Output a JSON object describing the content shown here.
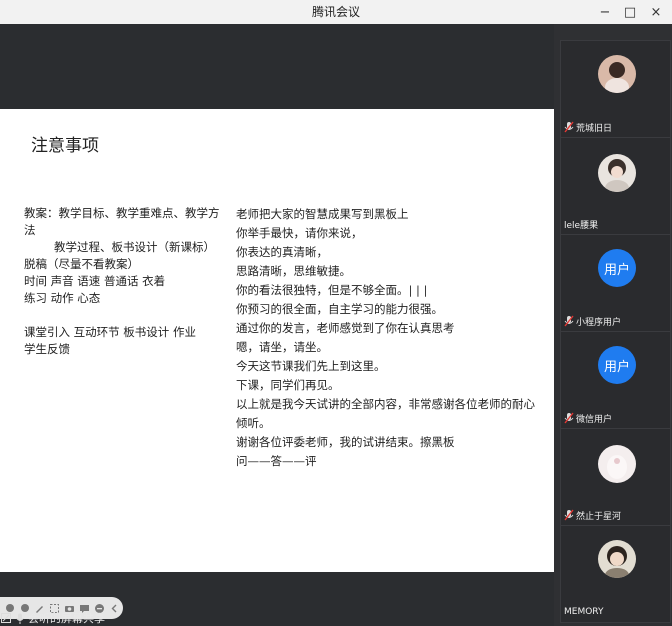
{
  "window": {
    "title": "腾讯会议",
    "minimize": "−",
    "maximize": "□",
    "close": "×"
  },
  "slide": {
    "heading": "注意事项",
    "left_lines": [
      "教案：教学目标、教学重难点、教学方法",
      "教学过程、板书设计（新课标）",
      "脱稿（尽量不看教案）",
      "时间 声音 语速 普通话 衣着",
      "练习 动作 心态",
      "",
      "课堂引入 互动环节 板书设计 作业",
      "学生反馈"
    ],
    "right_lines": [
      "老师把大家的智慧成果写到黑板上",
      "你举手最快，请你来说，",
      "你表达的真清晰，",
      "思路清晰，思维敏捷。",
      "你的看法很独特，但是不够全面。| | |",
      "你预习的很全面，自主学习的能力很强。",
      "通过你的发言，老师感觉到了你在认真思考",
      "嗯，请坐，请坐。",
      "今天这节课我们先上到这里。",
      "下课，同学们再见。",
      "以上就是我今天试讲的全部内容，非常感谢各位老师的耐心倾听。",
      "谢谢各位评委老师，我的试讲结束。擦黑板",
      "问——答——评"
    ]
  },
  "annotation_toolbar": {
    "tools": [
      "circle-icon",
      "circle-icon",
      "pen-icon",
      "select-icon",
      "camera-icon",
      "comment-icon",
      "stop-icon",
      "collapse-icon"
    ]
  },
  "status": {
    "text": "会听的屏幕共享"
  },
  "participants": [
    {
      "name": "荒城旧日",
      "avatar": "photo",
      "muted": true
    },
    {
      "name": "lele腰果",
      "avatar": "photo",
      "muted": false
    },
    {
      "name": "小程序用户",
      "avatar": "text",
      "avatar_text": "用户",
      "muted": true
    },
    {
      "name": "微信用户",
      "avatar": "text",
      "avatar_text": "用户",
      "muted": true
    },
    {
      "name": "然止于星河",
      "avatar": "photo",
      "muted": true
    },
    {
      "name": "MEMORY",
      "avatar": "photo",
      "muted": false
    }
  ],
  "colors": {
    "accent": "#1f7cf0",
    "background": "#1f2022",
    "slide": "#ffffff",
    "mute_red": "#e53935"
  }
}
